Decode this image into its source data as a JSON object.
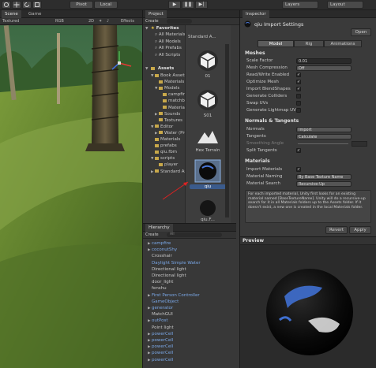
{
  "toolbar": {
    "pivot_label": "Pivot",
    "local_label": "Local",
    "layers_label": "Layers",
    "layout_label": "Layout"
  },
  "scene": {
    "tab_scene": "Scene",
    "tab_game": "Game",
    "render_mode": "Textured",
    "color_mode": "RGB",
    "mode_2d": "2D",
    "effects_label": "Effects"
  },
  "project": {
    "tab_label": "Project",
    "create_label": "Create",
    "favorites_label": "Favorites",
    "favorites": [
      "All Materials",
      "All Models",
      "All Prefabs",
      "All Scripts"
    ],
    "assets_label": "Assets",
    "tree": [
      {
        "label": "Book Assets",
        "indent": 1,
        "arrow": "▼"
      },
      {
        "label": "Materials",
        "indent": 2,
        "arrow": ""
      },
      {
        "label": "Models",
        "indent": 2,
        "arrow": "▼"
      },
      {
        "label": "campfire",
        "indent": 3,
        "arrow": ""
      },
      {
        "label": "matchbox",
        "indent": 3,
        "arrow": ""
      },
      {
        "label": "Materials",
        "indent": 3,
        "arrow": ""
      },
      {
        "label": "Sounds",
        "indent": 2,
        "arrow": "▶"
      },
      {
        "label": "Textures",
        "indent": 2,
        "arrow": ""
      },
      {
        "label": "Editor",
        "indent": 1,
        "arrow": "▼"
      },
      {
        "label": "Water (Pro)",
        "indent": 2,
        "arrow": "▶"
      },
      {
        "label": "Materials",
        "indent": 1,
        "arrow": ""
      },
      {
        "label": "prefabs",
        "indent": 1,
        "arrow": ""
      },
      {
        "label": "qiu.fbm",
        "indent": 1,
        "arrow": ""
      },
      {
        "label": "scripts",
        "indent": 1,
        "arrow": "▼"
      },
      {
        "label": "player",
        "indent": 2,
        "arrow": ""
      },
      {
        "label": "Standard Assets",
        "indent": 1,
        "arrow": "▶"
      }
    ],
    "path_label": "Standard A...",
    "assets": [
      {
        "label": "01"
      },
      {
        "label": "S01"
      },
      {
        "label": "Hex Terrain"
      },
      {
        "label": "qiu"
      },
      {
        "label": "qiu.F..."
      }
    ]
  },
  "hierarchy": {
    "tab_label": "Hierarchy",
    "create_label": "Create",
    "search_placeholder": "All",
    "items": [
      {
        "label": "campfire",
        "blue": true,
        "arrow": "▶"
      },
      {
        "label": "coconutShy",
        "blue": true,
        "arrow": "▶"
      },
      {
        "label": "Crosshair",
        "blue": false,
        "arrow": ""
      },
      {
        "label": "Daylight Simple Water",
        "blue": true,
        "arrow": ""
      },
      {
        "label": "Directional light",
        "blue": false,
        "arrow": ""
      },
      {
        "label": "Directional light",
        "blue": false,
        "arrow": ""
      },
      {
        "label": "door_light",
        "blue": false,
        "arrow": ""
      },
      {
        "label": "fenshu",
        "blue": false,
        "arrow": ""
      },
      {
        "label": "First Person Controller",
        "blue": true,
        "arrow": "▶"
      },
      {
        "label": "GameObject",
        "blue": true,
        "arrow": ""
      },
      {
        "label": "generator",
        "blue": true,
        "arrow": "▶"
      },
      {
        "label": "MatchGUI",
        "blue": false,
        "arrow": ""
      },
      {
        "label": "outPost",
        "blue": true,
        "arrow": "▶"
      },
      {
        "label": "Point light",
        "blue": false,
        "arrow": ""
      },
      {
        "label": "powerCell",
        "blue": true,
        "arrow": "▶"
      },
      {
        "label": "powerCell",
        "blue": true,
        "arrow": "▶"
      },
      {
        "label": "powerCell",
        "blue": true,
        "arrow": "▶"
      },
      {
        "label": "powerCell",
        "blue": true,
        "arrow": "▶"
      },
      {
        "label": "powerCell",
        "blue": true,
        "arrow": "▶"
      }
    ]
  },
  "inspector": {
    "tab_label": "Inspector",
    "title": "qiu Import Settings",
    "open_label": "Open",
    "tabs": [
      "Model",
      "Rig",
      "Animations"
    ],
    "meshes_label": "Meshes",
    "scale_factor_label": "Scale Factor",
    "scale_factor_value": "0.01",
    "mesh_compression_label": "Mesh Compression",
    "mesh_compression_value": "Off",
    "read_write_label": "Read/Write Enabled",
    "optimize_mesh_label": "Optimize Mesh",
    "import_blendshapes_label": "Import BlendShapes",
    "generate_colliders_label": "Generate Colliders",
    "swap_uvs_label": "Swap UVs",
    "generate_lightmap_label": "Generate Lightmap UVs",
    "normals_section": "Normals & Tangents",
    "normals_label": "Normals",
    "normals_value": "Import",
    "tangents_label": "Tangents",
    "tangents_value": "Calculate",
    "smoothing_label": "Smoothing Angle",
    "split_tangents_label": "Split Tangents",
    "materials_section": "Materials",
    "import_materials_label": "Import Materials",
    "material_naming_label": "Material Naming",
    "material_naming_value": "By Base Texture Name",
    "material_search_label": "Material Search",
    "material_search_value": "Recursive-Up",
    "help_text": "For each imported material, Unity first looks for an existing material named [BaseTextureName]. Unity will do a recursive-up search for it in all Materials folders up to the Assets folder. If it doesn't exist, a new one is created in the local Materials folder.",
    "revert_label": "Revert",
    "apply_label": "Apply"
  },
  "preview": {
    "label": "Preview"
  },
  "colors": {
    "selection": "#3b5b8c",
    "hierarchy_blue": "#7aa7e6",
    "folder": "#c8a84a"
  }
}
